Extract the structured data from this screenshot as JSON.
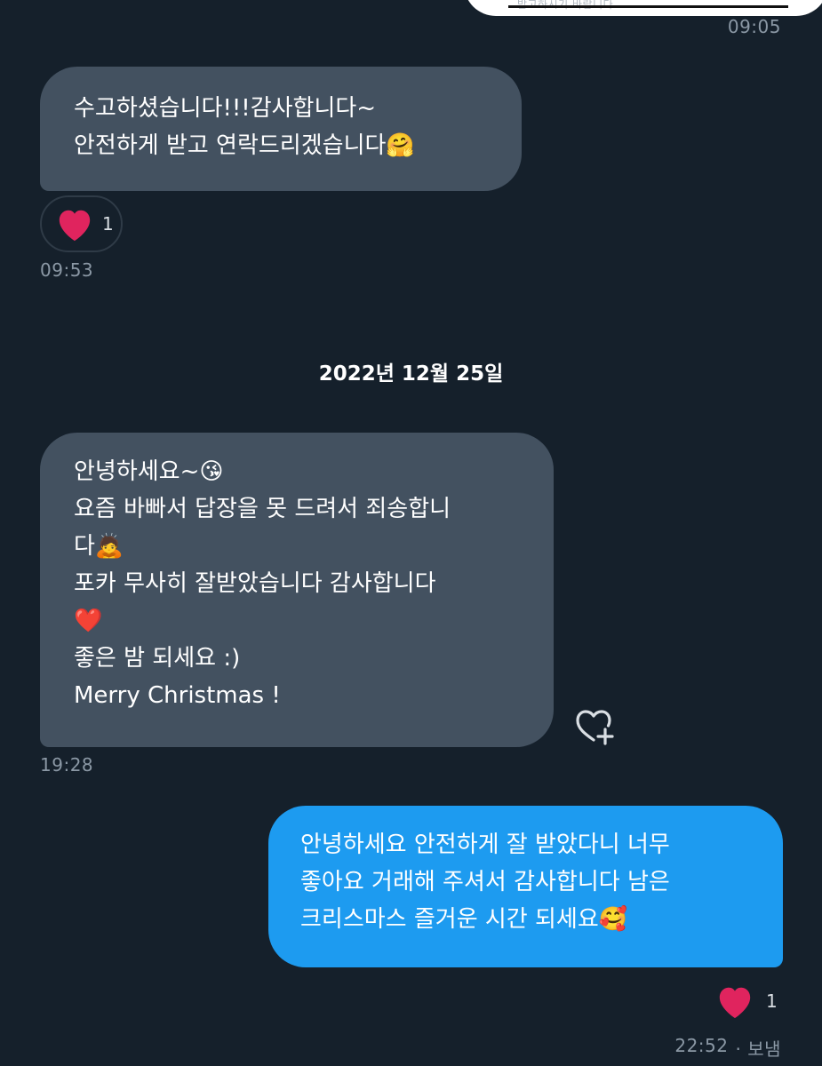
{
  "top_message": {
    "faint_text": "받고하시기 바랍니다.",
    "time": "09:05"
  },
  "message1": {
    "lines": [
      "수고하셨습니다!!!감사합니다~",
      "안전하게 받고 연락드리겠습니다🤗"
    ],
    "reaction_icon": "heart-icon",
    "reaction_count": "1",
    "time": "09:53"
  },
  "date_separator": "2022년 12월 25일",
  "message2": {
    "lines": [
      "안녕하세요~😘",
      "요즘 바빠서 답장을 못 드려서 죄송합니",
      "다🙇",
      "포카 무사히 잘받았습니다 감사합니다",
      "❤️",
      "좋은 밤 되세요 :)",
      "Merry Christmas !"
    ],
    "add_reaction_icon": "heart-plus-icon",
    "time": "19:28"
  },
  "message3": {
    "lines": [
      "안녕하세요 안전하게 잘 받았다니 너무",
      "좋아요 거래해 주셔서 감사합니다 남은",
      "크리스마스 즐거운 시간 되세요🥰"
    ],
    "reaction_icon": "heart-icon",
    "reaction_count": "1",
    "time": "22:52",
    "status": "· 보냄"
  },
  "colors": {
    "background": "#15202b",
    "incoming_bubble": "#435160",
    "outgoing_bubble": "#1d9bf0",
    "heart": "#e0245e",
    "muted_text": "#8b98a5"
  }
}
